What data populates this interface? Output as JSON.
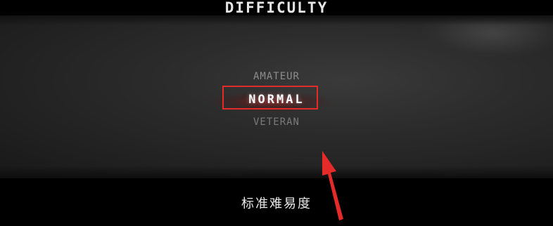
{
  "title": "DIFFICULTY",
  "options": {
    "amateur": "AMATEUR",
    "normal": "NORMAL",
    "veteran": "VETERAN"
  },
  "subtitle": "标准难易度",
  "colors": {
    "highlight": "#e52a2a",
    "arrow": "#e52a2a"
  },
  "icons": [
    "arrow-up-icon"
  ]
}
